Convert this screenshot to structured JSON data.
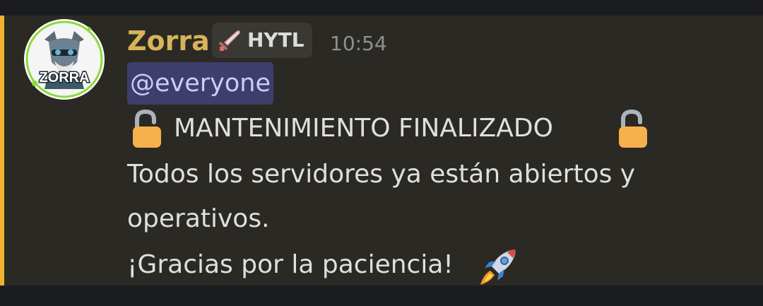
{
  "message": {
    "author": {
      "username": "Zorra",
      "avatar_text": "ZORRA",
      "role_tag": "HYTL",
      "role_tag_icon": "sword-icon",
      "timestamp": "10:54"
    },
    "mention": "@everyone",
    "title": "MANTENIMIENTO FINALIZADO",
    "title_icon": "unlocked-lock-icon",
    "body_line_1": "Todos los servidores ya están abiertos y",
    "body_line_2": "operativos.",
    "body_line_3": "¡Gracias por la paciencia!",
    "body_line_3_icon": "rocket-icon"
  },
  "colors": {
    "background": "#1b1c20",
    "message_highlight": "#2b2923",
    "mention_bar": "#f0b132",
    "username": "#d9b35a",
    "mention_bg": "#3d3e6a",
    "mention_text": "#c9cdfb",
    "text": "#dfdfdf",
    "timestamp": "#8e9093"
  }
}
